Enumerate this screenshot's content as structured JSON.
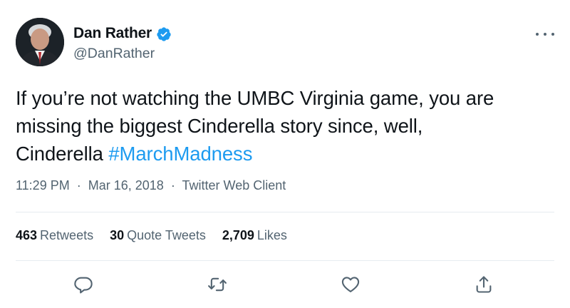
{
  "author": {
    "name": "Dan Rather",
    "handle": "@DanRather",
    "avatar_icon": "profile-photo",
    "verified_icon": "verified-badge-icon",
    "verified_color": "#1d9bf0"
  },
  "tweet": {
    "text_lines": [
      "If you’re not watching the UMBC Virginia game, you are",
      "missing the biggest Cinderella story since, well,",
      "Cinderella "
    ],
    "hashtag": "#MarchMadness",
    "hashtag_color": "#1d9bf0"
  },
  "meta": {
    "time": "11:29 PM",
    "date": "Mar 16, 2018",
    "source": "Twitter Web Client",
    "separator": "·"
  },
  "stats": {
    "retweets": {
      "count": "463",
      "label": "Retweets"
    },
    "quote_tweets": {
      "count": "30",
      "label": "Quote Tweets"
    },
    "likes": {
      "count": "2,709",
      "label": "Likes"
    }
  },
  "actions": [
    "reply-icon",
    "retweet-icon",
    "like-icon",
    "share-icon"
  ],
  "colors": {
    "text": "#0f1419",
    "secondary": "#536471",
    "divider": "#e6ecf0"
  }
}
